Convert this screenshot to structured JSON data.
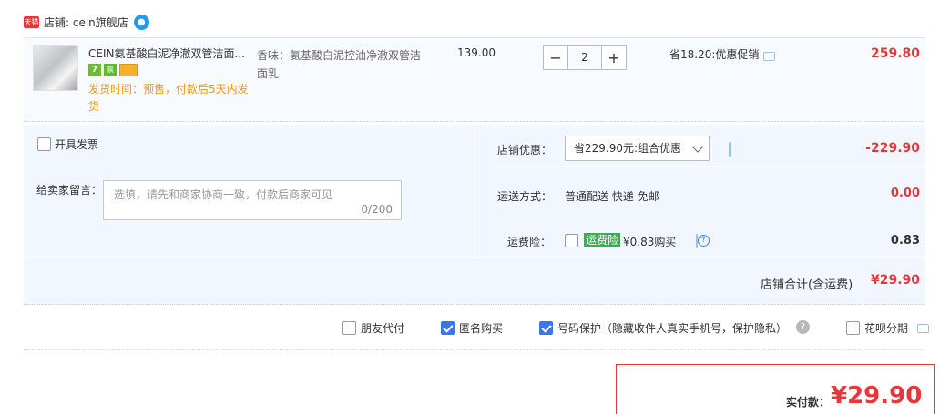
{
  "shop": {
    "badge": "天猫",
    "label": "店铺: cein旗舰店"
  },
  "item": {
    "name": "CEIN氨基酸白泥净澈双管洁面...",
    "badge_7": "7",
    "badge_invoice": "票",
    "ship_time": "发货时间：预售，付款后5天内发货",
    "sku": "香味：氨基酸白泥控油净澈双管洁面乳",
    "price": "139.00",
    "qty_minus": "−",
    "qty": "2",
    "qty_plus": "+",
    "save": "省18.20:优惠促销",
    "total": "259.80"
  },
  "invoice_label": "开具发票",
  "memo": {
    "label": "给卖家留言：",
    "placeholder": "选填，请先和商家协商一致，付款后商家可见",
    "count": "0/200"
  },
  "shop_discount": {
    "label": "店铺优惠：",
    "selected": "省229.90元:组合优惠",
    "value": "-229.90"
  },
  "shipping": {
    "label": "运送方式：",
    "value": "普通配送 快递 免邮",
    "cost": "0.00"
  },
  "insurance": {
    "label": "运费险：",
    "tag": "运费险",
    "text": "¥0.83购买",
    "help": "?",
    "value": "0.83"
  },
  "subtotal": {
    "label": "店铺合计(含运费)",
    "value": "¥29.90"
  },
  "options": {
    "friend_pay": "朋友代付",
    "anonymous": "匿名购买",
    "number_protect": "号码保护（隐藏收件人真实手机号，保护隐私）",
    "help": "?",
    "huabei": "花呗分期"
  },
  "payment": {
    "label": "实付款：",
    "value": "¥29.90"
  }
}
